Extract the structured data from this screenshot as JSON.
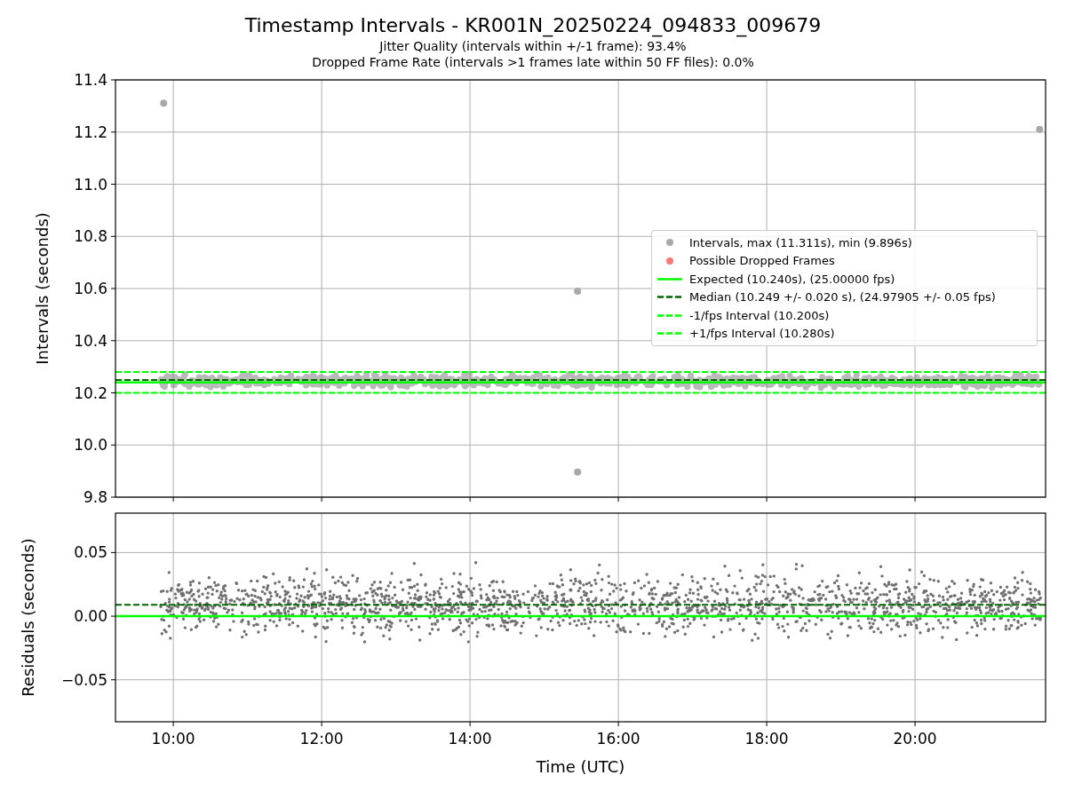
{
  "figure": {
    "title": "Timestamp Intervals - KR001N_20250224_094833_009679",
    "subtitle_lines": [
      "Jitter Quality (intervals within +/-1 frame): 93.4%",
      "Dropped Frame Rate (intervals >1 frames late within 50 FF files): 0.0%"
    ]
  },
  "top_chart": {
    "chart_data": {
      "type": "scatter",
      "ylabel": "Intervals (seconds)",
      "xlim": [
        9.22,
        21.76
      ],
      "ylim": [
        9.8,
        11.4
      ],
      "grid": true,
      "yticks": [
        {
          "value": 9.8,
          "label": "9.8"
        },
        {
          "value": 10.0,
          "label": "10.0"
        },
        {
          "value": 10.2,
          "label": "10.2"
        },
        {
          "value": 10.4,
          "label": "10.4"
        },
        {
          "value": 10.6,
          "label": "10.6"
        },
        {
          "value": 10.8,
          "label": "10.8"
        },
        {
          "value": 11.0,
          "label": "11.0"
        },
        {
          "value": 11.2,
          "label": "11.2"
        },
        {
          "value": 11.4,
          "label": "11.4"
        }
      ],
      "series": [
        {
          "name": "Intervals, max (11.311s), min (9.896s)",
          "color": "#a9a9a9",
          "x": [
            9.87,
            15.45,
            15.45,
            21.68
          ],
          "values": [
            11.311,
            10.59,
            9.896,
            11.21
          ]
        }
      ],
      "ref_lines": [
        {
          "axis": "y",
          "value": 10.24,
          "color": "#00ff00"
        },
        {
          "axis": "y",
          "value": 10.249,
          "color": "#006400"
        },
        {
          "axis": "y",
          "value": 10.2,
          "color": "#00ff00"
        },
        {
          "axis": "y",
          "value": 10.28,
          "color": "#00ff00"
        }
      ]
    },
    "legend": [
      {
        "kind": "marker",
        "color": "#a9a9a9"
      },
      {
        "label": "Possible Dropped Frames",
        "kind": "marker",
        "color": "#f47a7a"
      },
      {
        "label": "Expected (10.240s), (25.00000 fps)",
        "kind": "solid",
        "color": "#00ff00"
      },
      {
        "label": "Median (10.249 +/- 0.020 s), (24.97905 +/- 0.05 fps)",
        "kind": "dashed",
        "color": "#006400"
      },
      {
        "label": "-1/fps Interval (10.200s)",
        "kind": "dashed",
        "color": "#00ff00"
      },
      {
        "label": "+1/fps Interval (10.280s)",
        "kind": "dashed",
        "color": "#00ff00"
      }
    ]
  },
  "bottom_chart": {
    "chart_data": {
      "type": "scatter",
      "xlabel": "Time (UTC)",
      "ylabel": "Residuals (seconds)",
      "xlim": [
        9.22,
        21.76
      ],
      "ylim": [
        -0.083,
        0.081
      ],
      "grid": true,
      "xticks": [
        {
          "value": 10,
          "label": "10:00"
        },
        {
          "value": 12,
          "label": "12:00"
        },
        {
          "value": 14,
          "label": "14:00"
        },
        {
          "value": 16,
          "label": "16:00"
        },
        {
          "value": 18,
          "label": "18:00"
        },
        {
          "value": 20,
          "label": "20:00"
        }
      ],
      "yticks": [
        {
          "value": -0.05,
          "label": "−0.05"
        },
        {
          "value": 0,
          "label": "0.00"
        },
        {
          "value": 0.05,
          "label": "0.05"
        }
      ],
      "ref_lines": [
        {
          "axis": "y",
          "value": 0,
          "color": "#00ff00"
        },
        {
          "axis": "y",
          "value": 0.009,
          "color": "#006400"
        }
      ]
    }
  }
}
